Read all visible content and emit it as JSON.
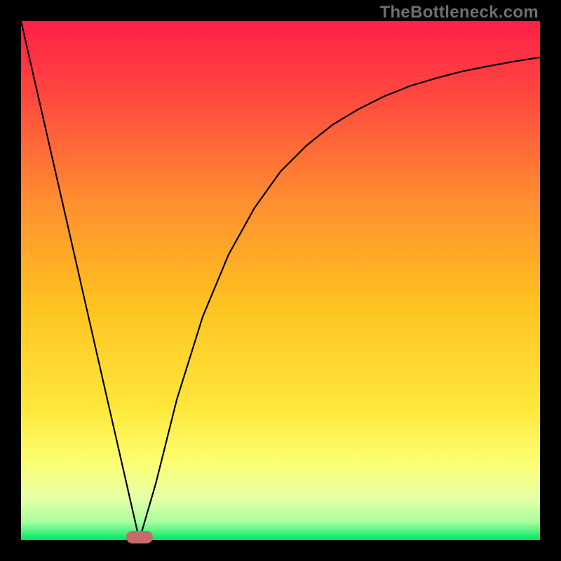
{
  "watermark": "TheBottleneck.com",
  "chart_data": {
    "type": "line",
    "title": "",
    "xlabel": "",
    "ylabel": "",
    "xlim": [
      0,
      1
    ],
    "ylim": [
      0,
      1
    ],
    "grid": false,
    "legend": false,
    "gradient_stops": [
      {
        "offset": 0.0,
        "color": "#ff1f46"
      },
      {
        "offset": 0.15,
        "color": "#ff4a3f"
      },
      {
        "offset": 0.35,
        "color": "#ff8f2f"
      },
      {
        "offset": 0.55,
        "color": "#ffc320"
      },
      {
        "offset": 0.75,
        "color": "#ffe83c"
      },
      {
        "offset": 0.85,
        "color": "#fcff72"
      },
      {
        "offset": 0.92,
        "color": "#e6ffa6"
      },
      {
        "offset": 0.965,
        "color": "#a8ff9e"
      },
      {
        "offset": 1.0,
        "color": "#00e765"
      }
    ],
    "series": [
      {
        "name": "curve",
        "stroke": "#000000",
        "x": [
          0.0,
          0.05,
          0.1,
          0.15,
          0.2,
          0.228,
          0.26,
          0.3,
          0.35,
          0.4,
          0.45,
          0.5,
          0.55,
          0.6,
          0.65,
          0.7,
          0.75,
          0.8,
          0.85,
          0.9,
          0.95,
          1.0
        ],
        "y": [
          1.0,
          0.781,
          0.562,
          0.342,
          0.123,
          0.0,
          0.11,
          0.27,
          0.43,
          0.55,
          0.64,
          0.71,
          0.76,
          0.8,
          0.83,
          0.855,
          0.875,
          0.89,
          0.903,
          0.913,
          0.922,
          0.93
        ]
      }
    ],
    "marker": {
      "x": 0.228,
      "y": 0.0,
      "color": "#c96a6a"
    }
  }
}
